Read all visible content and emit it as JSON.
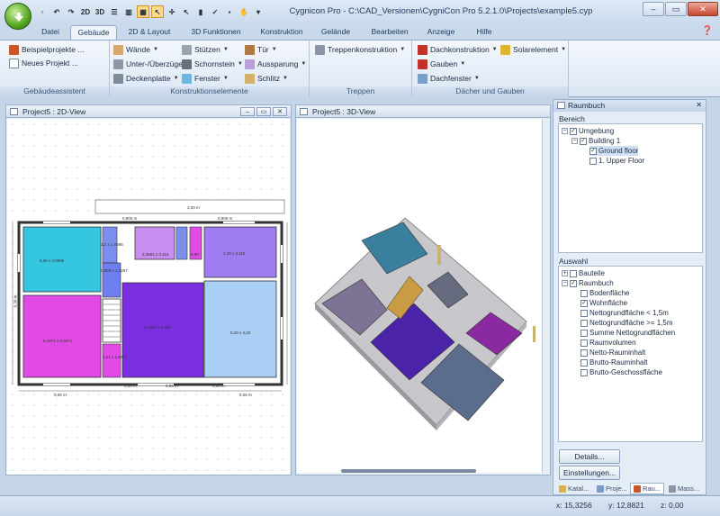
{
  "window": {
    "title": "Cygnicon Pro  -  C:\\CAD_Versionen\\CygniCon Pro 5.2.1.0\\Projects\\example5.cyp"
  },
  "tabs": [
    "Datei",
    "Gebäude",
    "2D & Layout",
    "3D Funktionen",
    "Konstruktion",
    "Gelände",
    "Bearbeiten",
    "Anzeige",
    "Hilfe"
  ],
  "ribbon": {
    "assist": {
      "label": "Gebäudeassistent",
      "items": [
        "Beispielprojekte ...",
        "Neues Projekt ..."
      ]
    },
    "konstr": {
      "label": "Konstruktionselemente",
      "items": [
        "Wände",
        "Unter-/Überzüge",
        "Deckenplatte",
        "Stützen",
        "Schornstein",
        "Fenster",
        "Tür",
        "Aussparung",
        "Schlitz"
      ]
    },
    "treppen": {
      "label": "Treppen",
      "items": [
        "Treppenkonstruktion"
      ]
    },
    "dach": {
      "label": "Dächer und Gauben",
      "items": [
        "Dachkonstruktion",
        "Solarelement",
        "Gauben",
        "Dachfenster"
      ]
    }
  },
  "view2d": {
    "title": "Project5 : 2D-View"
  },
  "view3d": {
    "title": "Project5 : 3D-View"
  },
  "raumbuch": {
    "title": "Raumbuch",
    "bereich_label": "Bereich",
    "bereich": [
      "Umgebung",
      "Building 1",
      "Ground floor",
      "1. Upper Floor"
    ],
    "auswahl_label": "Auswahl",
    "auswahl": [
      "Bauteile",
      "Raumbuch",
      "Bodenfläche",
      "Wohnfläche",
      "Nettogrundfläche < 1,5m",
      "Nettogrundfläche >= 1,5m",
      "Summe Nettogrundflächen",
      "Raumvolumen",
      "Netto-Rauminhalt",
      "Brutto-Rauminhalt",
      "Brutto-Geschossfläche"
    ],
    "details_button": "Details...",
    "settings_button": "Einstellungen...",
    "bottom_tabs": [
      "Katal...",
      "Proje...",
      "Rau...",
      "Mass..."
    ]
  },
  "rooms2d": [
    "6,95 x 3,9695",
    "2,3681 x 3,116",
    "4,20 x 3,115",
    "0,90",
    "6,1520 x 6,360",
    "6,20 x 4,20",
    "5,1871 x 5,6671",
    "1,21 x 1,6717",
    "1,2 x 1,0695",
    "0,903 x 1,4287"
  ],
  "dims2d": [
    "3,00 m",
    "0,905 m",
    "0,905 m",
    "0,30 m",
    "0,06 m",
    "0,06 m",
    "0,06 m",
    "0,06 m",
    "0,06 m"
  ],
  "status": {
    "x": "x: 15,3256",
    "y": "y: 12,8821",
    "z": "z: 0,00"
  },
  "colors": {
    "accent": "#4a7dbd",
    "cyan": "#35c6e0",
    "magenta": "#e24ae6",
    "purple": "#7c2fe0",
    "violet": "#9f7cf0",
    "lightblue": "#a9cff4"
  }
}
